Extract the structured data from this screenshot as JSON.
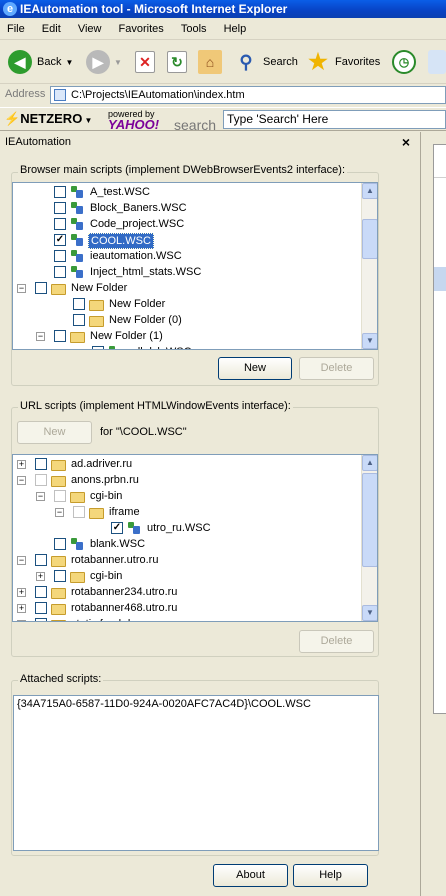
{
  "window": {
    "title": "IEAutomation tool - Microsoft Internet Explorer"
  },
  "menu": [
    "File",
    "Edit",
    "View",
    "Favorites",
    "Tools",
    "Help"
  ],
  "toolbar": {
    "back": "Back",
    "search": "Search",
    "favorites": "Favorites"
  },
  "address": {
    "label": "Address",
    "value": "C:\\Projects\\IEAutomation\\index.htm"
  },
  "netzero": {
    "logo": "NETZERO",
    "powered_by": "powered by",
    "yahoo": "YAHOO!",
    "search_word": "search",
    "search_placeholder": "Type 'Search' Here"
  },
  "panel": {
    "title": "IEAutomation",
    "close": "×"
  },
  "main_scripts": {
    "legend": "Browser main scripts (implement DWebBrowserEvents2 interface):",
    "items": [
      {
        "label": "A_test.WSC",
        "type": "wsc",
        "checked": false
      },
      {
        "label": "Block_Baners.WSC",
        "type": "wsc",
        "checked": false
      },
      {
        "label": "Code_project.WSC",
        "type": "wsc",
        "checked": false
      },
      {
        "label": "COOL.WSC",
        "type": "wsc",
        "checked": true,
        "selected": true
      },
      {
        "label": "ieautomation.WSC",
        "type": "wsc",
        "checked": false
      },
      {
        "label": "Inject_html_stats.WSC",
        "type": "wsc",
        "checked": false
      },
      {
        "label": "New Folder",
        "type": "folder",
        "checked": false,
        "expander": "−"
      },
      {
        "label": "New Folder",
        "type": "folder",
        "checked": false
      },
      {
        "label": "New Folder (0)",
        "type": "folder",
        "checked": false
      },
      {
        "label": "New Folder (1)",
        "type": "folder",
        "checked": false,
        "expander": "−"
      },
      {
        "label": "adkdsk.WSC",
        "type": "wsc",
        "checked": false
      }
    ],
    "new_button": "New",
    "delete_button": "Delete"
  },
  "url_scripts": {
    "legend": "URL scripts (implement HTMLWindowEvents interface):",
    "new_button": "New",
    "for_label": "for \"\\COOL.WSC\"",
    "items": [
      {
        "label": "ad.adriver.ru",
        "type": "folder",
        "checked": false,
        "expander": "+"
      },
      {
        "label": "anons.prbn.ru",
        "type": "folder",
        "checked": false,
        "expander": "−",
        "disabled": true
      },
      {
        "label": "cgi-bin",
        "type": "folder",
        "checked": false,
        "expander": "−",
        "disabled": true
      },
      {
        "label": "iframe",
        "type": "folder",
        "checked": false,
        "expander": "−",
        "disabled": true
      },
      {
        "label": "utro_ru.WSC",
        "type": "wsc",
        "checked": true
      },
      {
        "label": "blank.WSC",
        "type": "wsc",
        "checked": false
      },
      {
        "label": "rotabanner.utro.ru",
        "type": "folder",
        "checked": false,
        "expander": "−"
      },
      {
        "label": "cgi-bin",
        "type": "folder",
        "checked": false,
        "expander": "+"
      },
      {
        "label": "rotabanner234.utro.ru",
        "type": "folder",
        "checked": false,
        "expander": "+"
      },
      {
        "label": "rotabanner468.utro.ru",
        "type": "folder",
        "checked": false,
        "expander": "+"
      },
      {
        "label": "static.feed.rbc.ru",
        "type": "folder",
        "checked": false,
        "expander": "+"
      }
    ],
    "delete_button": "Delete"
  },
  "attached": {
    "legend": "Attached scripts:",
    "value": "{34A715A0-6587-11D0-924A-0020AFC7AC4D}\\COOL.WSC"
  },
  "footer": {
    "about_button": "About",
    "help_button": "Help"
  }
}
